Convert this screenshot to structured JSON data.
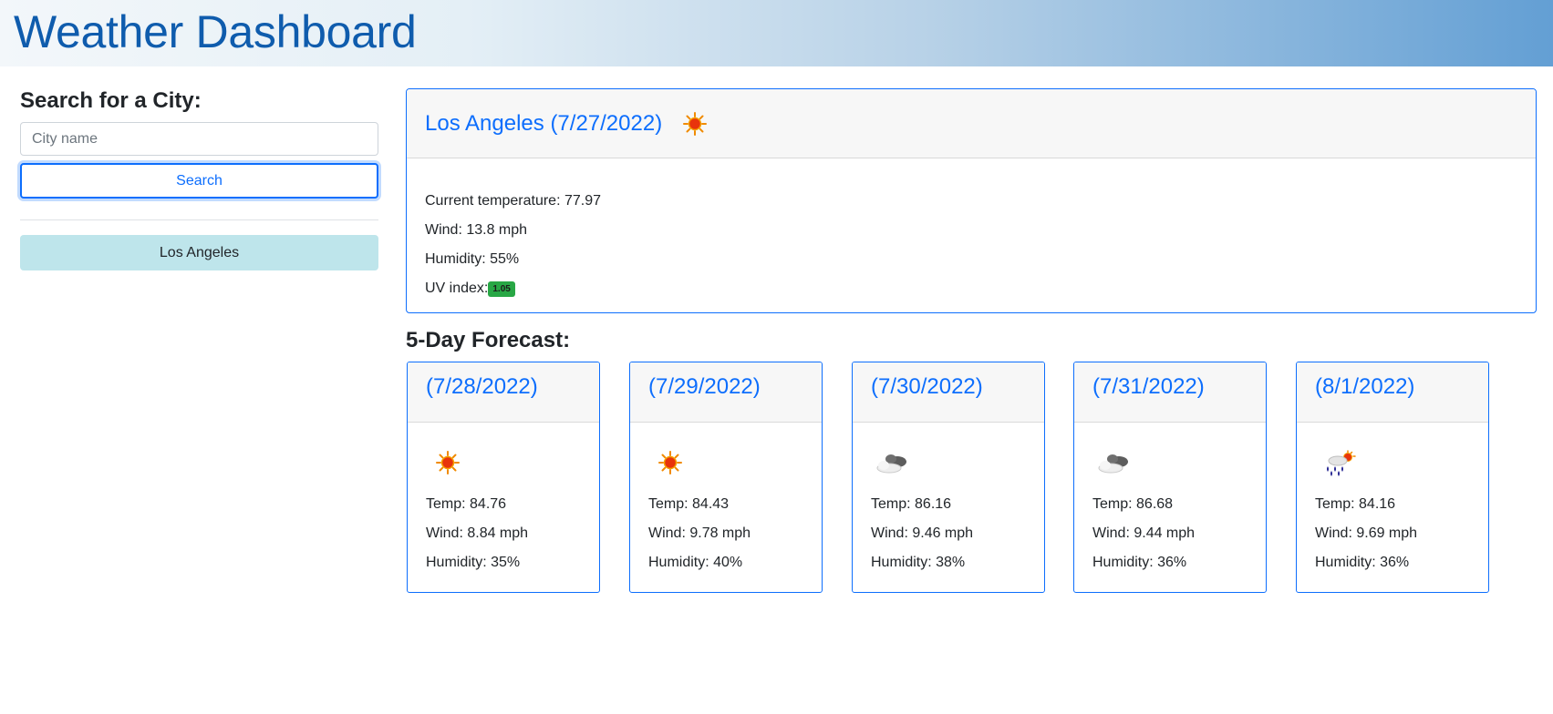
{
  "header": {
    "title": "Weather Dashboard"
  },
  "sidebar": {
    "heading": "Search for a City:",
    "search_placeholder": "City name",
    "search_value": "",
    "search_label": "Search",
    "history": [
      "Los Angeles"
    ]
  },
  "current": {
    "title": "Los Angeles (7/27/2022)",
    "icon": "sun-icon",
    "temperature_text": "Current temperature: 77.97",
    "wind_text": "Wind: 13.8 mph",
    "humidity_text": "Humidity: 55%",
    "uv_label": "UV index:",
    "uv_value": "1.05",
    "uv_color": "#28a745"
  },
  "forecast": {
    "heading": "5-Day Forecast:",
    "days": [
      {
        "date": "(7/28/2022)",
        "icon": "sun-icon",
        "temp": "Temp: 84.76",
        "wind": "Wind: 8.84 mph",
        "humidity": "Humidity: 35%"
      },
      {
        "date": "(7/29/2022)",
        "icon": "sun-icon",
        "temp": "Temp: 84.43",
        "wind": "Wind: 9.78 mph",
        "humidity": "Humidity: 40%"
      },
      {
        "date": "(7/30/2022)",
        "icon": "cloud-icon",
        "temp": "Temp: 86.16",
        "wind": "Wind: 9.46 mph",
        "humidity": "Humidity: 38%"
      },
      {
        "date": "(7/31/2022)",
        "icon": "cloud-icon",
        "temp": "Temp: 86.68",
        "wind": "Wind: 9.44 mph",
        "humidity": "Humidity: 36%"
      },
      {
        "date": "(8/1/2022)",
        "icon": "rain-sun-icon",
        "temp": "Temp: 84.16",
        "wind": "Wind: 9.69 mph",
        "humidity": "Humidity: 36%"
      }
    ]
  },
  "colors": {
    "accent": "#0d6efd",
    "title": "#0f5cad",
    "history_bg": "#bee5eb"
  }
}
